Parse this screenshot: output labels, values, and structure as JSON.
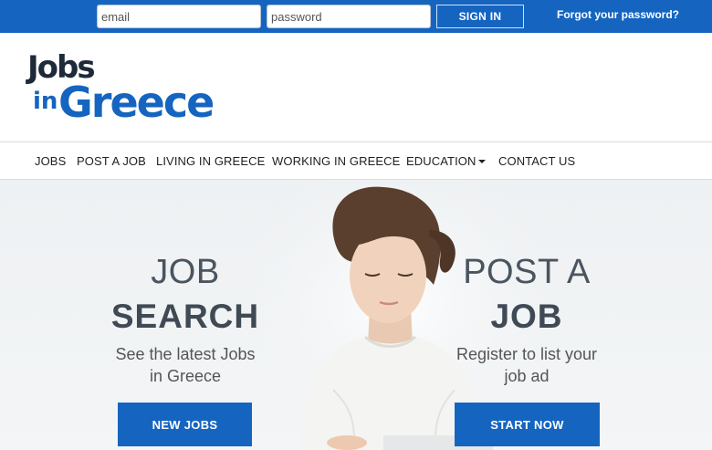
{
  "topbar": {
    "email_placeholder": "email",
    "password_placeholder": "password",
    "signin_label": "SIGN IN",
    "forgot_label": "Forgot your password?"
  },
  "logo": {
    "line1": "Jobs",
    "line2_small": "in",
    "line2_big": "Greece"
  },
  "nav": {
    "items": [
      {
        "label": "JOBS"
      },
      {
        "label": "POST A JOB"
      },
      {
        "label": "LIVING IN GREECE"
      },
      {
        "label": "WORKING IN GREECE"
      },
      {
        "label": "EDUCATION",
        "has_dropdown": true
      },
      {
        "label": "CONTACT US"
      }
    ]
  },
  "hero": {
    "left": {
      "heading_light": "JOB",
      "heading_bold": "SEARCH",
      "subtitle_line1": "See the latest Jobs",
      "subtitle_line2": "in Greece",
      "button_label": "NEW JOBS"
    },
    "right": {
      "heading_light": "POST A",
      "heading_bold": "JOB",
      "subtitle_line1": "Register to list your",
      "subtitle_line2": "job ad",
      "button_label": "START NOW"
    }
  },
  "colors": {
    "brand_blue": "#1565c0",
    "logo_dark": "#1e2a3a",
    "hero_bg": "#eef1f3",
    "heading_gray": "#4a5560"
  }
}
